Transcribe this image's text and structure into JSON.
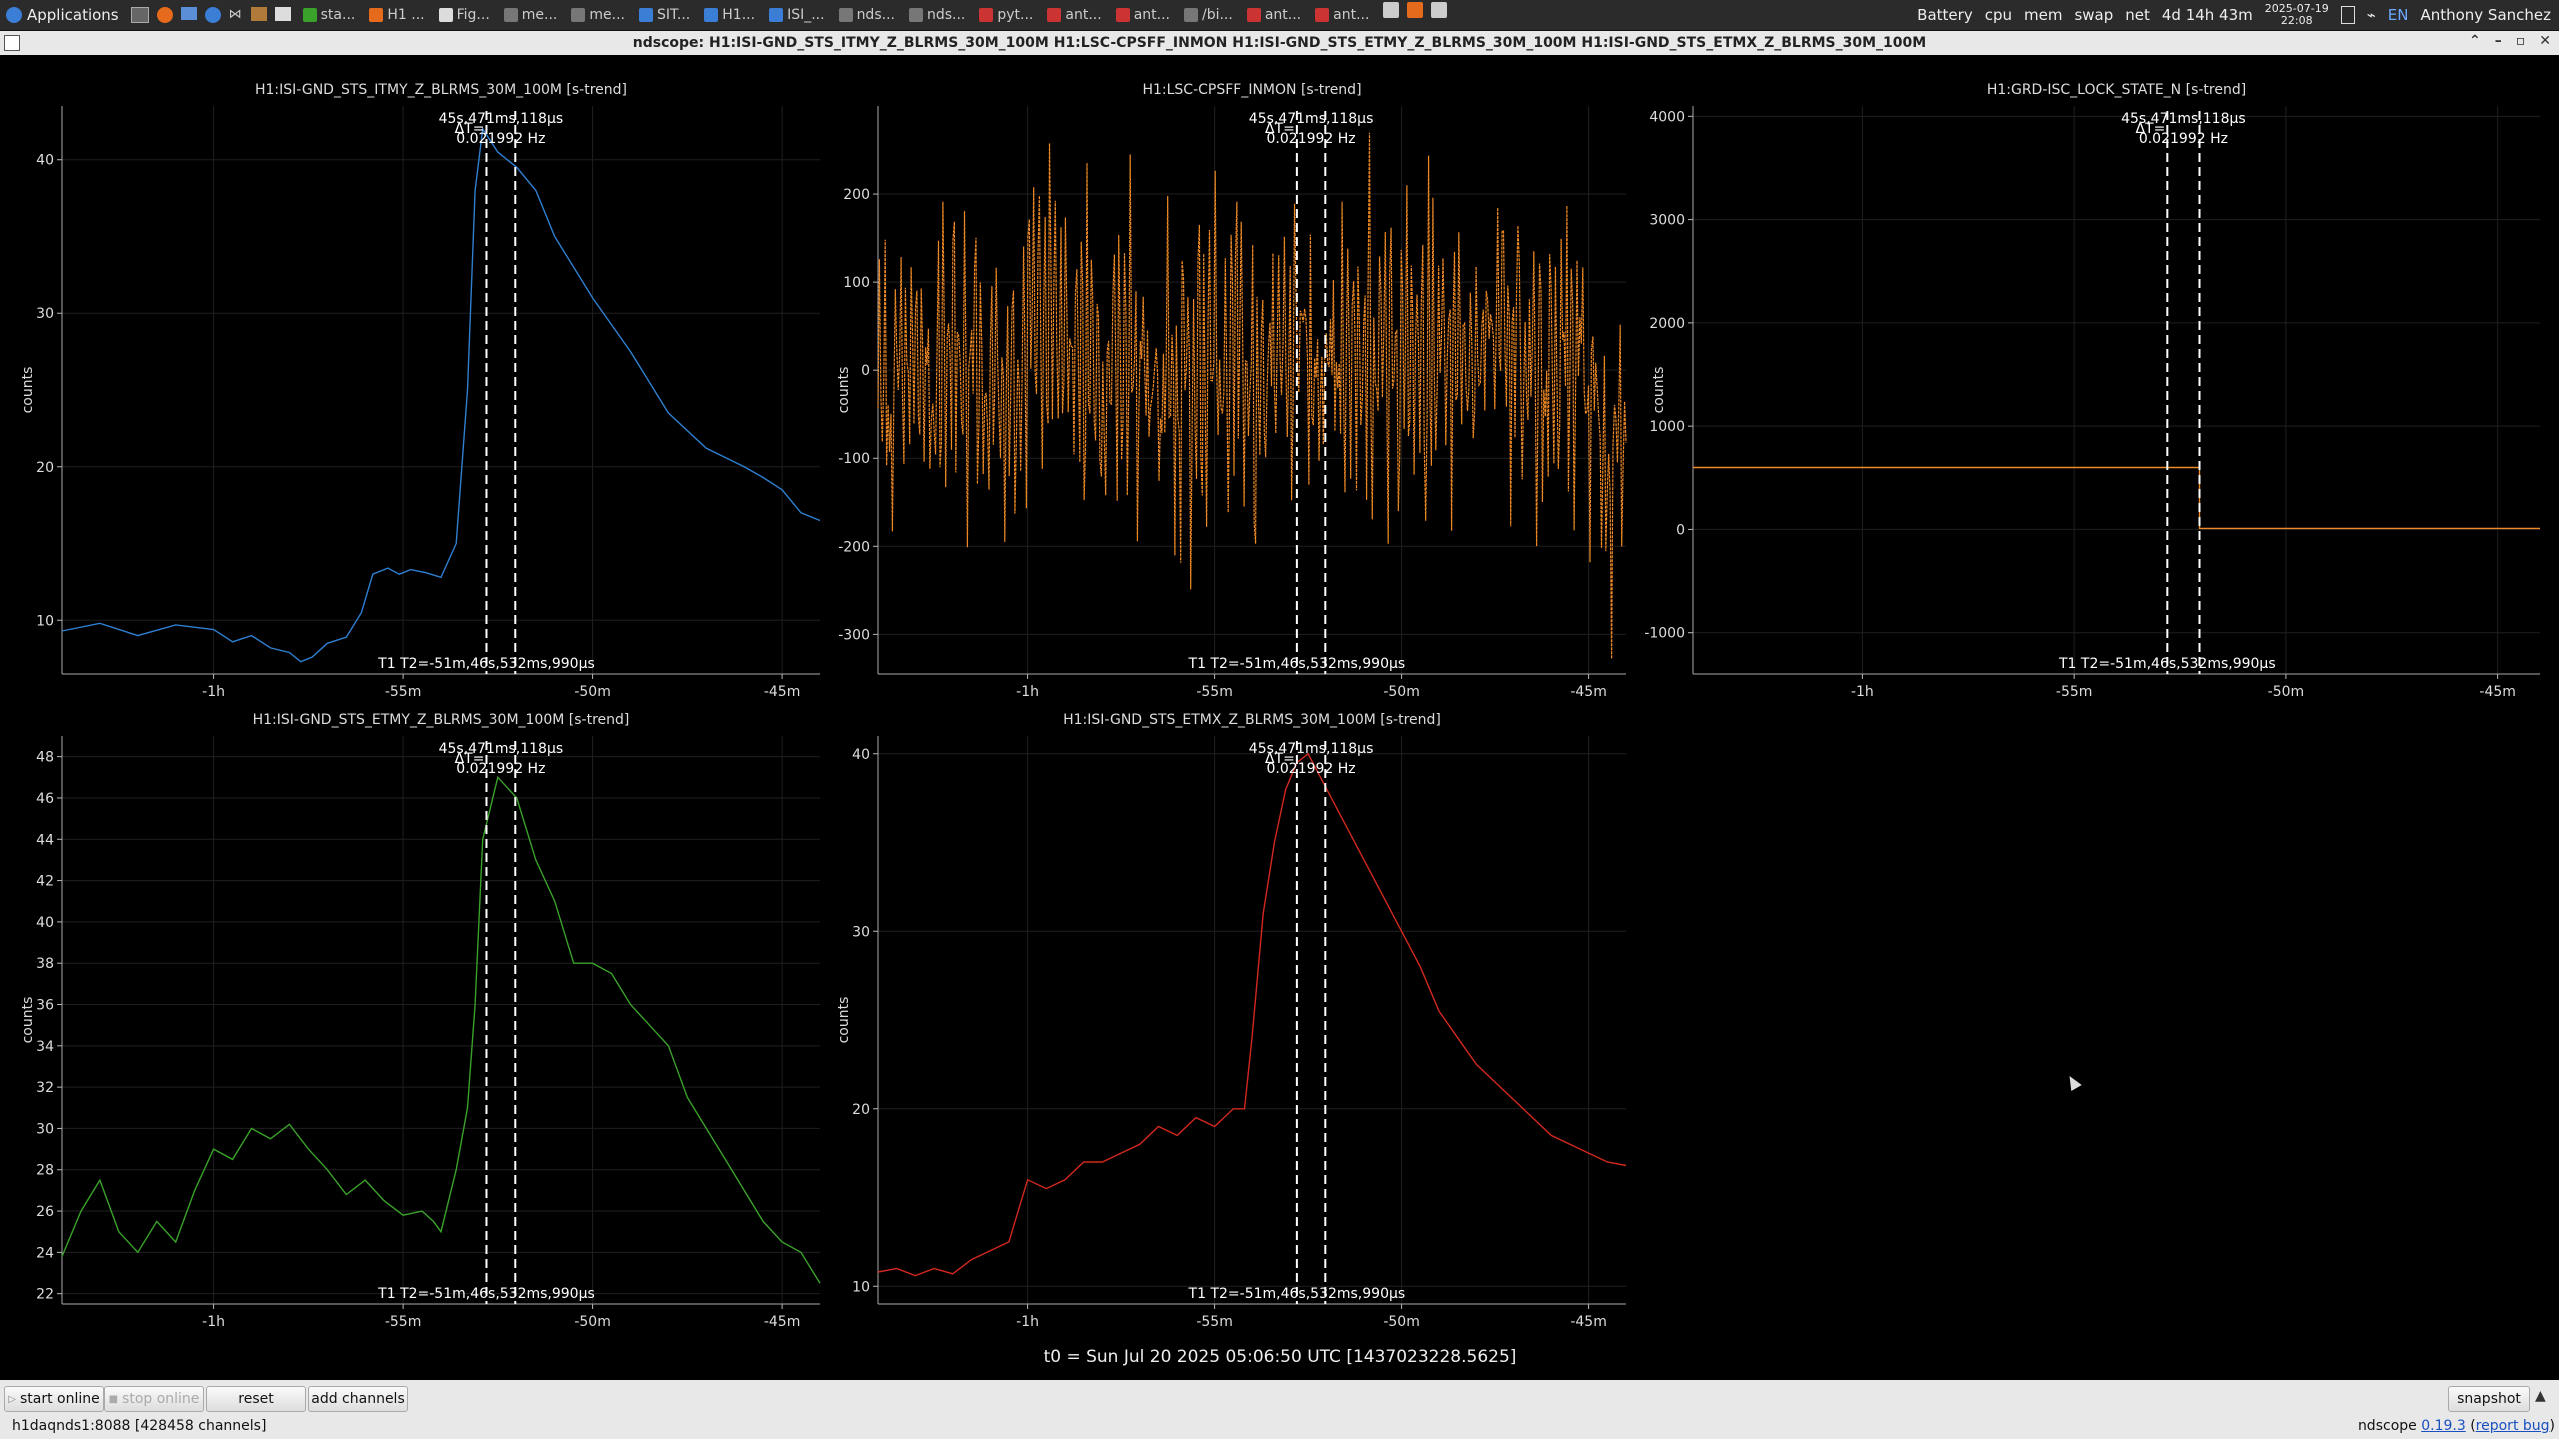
{
  "taskbar": {
    "applications_label": "Applications",
    "tasks": [
      "sta...",
      "H1 ...",
      "Fig...",
      "me...",
      "me...",
      "SIT...",
      "H1...",
      "ISI_...",
      "nds...",
      "nds...",
      "pyt...",
      "ant...",
      "ant...",
      "/bi...",
      "ant...",
      "ant..."
    ],
    "tray": {
      "battery": "Battery",
      "cpu": "cpu",
      "mem": "mem",
      "swap": "swap",
      "net": "net",
      "uptime": "4d 14h 43m",
      "date": "2025-07-19",
      "time": "22:08",
      "lang": "EN",
      "user": "Anthony Sanchez"
    }
  },
  "window": {
    "title": "ndscope: H1:ISI-GND_STS_ITMY_Z_BLRMS_30M_100M H1:LSC-CPSFF_INMON H1:ISI-GND_STS_ETMY_Z_BLRMS_30M_100M H1:ISI-GND_STS_ETMX_Z_BLRMS_30M_100M"
  },
  "cursor_text": {
    "delta": "ΔT=",
    "delta_time": "45s,471ms,118µs",
    "delta_freq": "0.021992 Hz",
    "t1t2": "T1 T2=-51m,46s,532ms,990µs"
  },
  "t0_label": "t0 = Sun Jul 20 2025 05:06:50 UTC [1437023228.5625]",
  "chart_data": [
    {
      "type": "line",
      "title": "H1:ISI-GND_STS_ITMY_Z_BLRMS_30M_100M [s-trend]",
      "ylabel": "counts",
      "color": "#2f7fd0",
      "xlim": [
        -64,
        -44
      ],
      "ylim": [
        6.5,
        43.5
      ],
      "yticks": [
        10,
        20,
        30,
        40
      ],
      "xticks": [
        {
          "v": -60,
          "l": "-1h"
        },
        {
          "v": -55,
          "l": "-55m"
        },
        {
          "v": -50,
          "l": "-50m"
        },
        {
          "v": -45,
          "l": "-45m"
        }
      ],
      "cursors": [
        -52.8,
        -52.04
      ],
      "x": [
        -64,
        -63,
        -62,
        -61,
        -60,
        -59.5,
        -59,
        -58.5,
        -58,
        -57.7,
        -57.4,
        -57,
        -56.5,
        -56.1,
        -55.8,
        -55.4,
        -55.1,
        -54.8,
        -54.4,
        -54,
        -53.6,
        -53.3,
        -53.1,
        -52.9,
        -52.5,
        -52,
        -51.5,
        -51,
        -50,
        -49,
        -48,
        -47,
        -46.5,
        -46,
        -45.5,
        -45,
        -44.5,
        -44
      ],
      "y": [
        9.3,
        9.8,
        9,
        9.7,
        9.4,
        8.6,
        9,
        8.2,
        7.9,
        7.3,
        7.6,
        8.5,
        8.9,
        10.5,
        13,
        13.4,
        13,
        13.3,
        13.1,
        12.8,
        15,
        25,
        38,
        42,
        40.5,
        39.5,
        38,
        35,
        31,
        27.5,
        23.5,
        21.2,
        20.6,
        20,
        19.3,
        18.5,
        17,
        16.5
      ]
    },
    {
      "type": "line",
      "title": "H1:LSC-CPSFF_INMON [s-trend]",
      "ylabel": "counts",
      "color": "#f08a24",
      "xlim": [
        -64,
        -44
      ],
      "ylim": [
        -345,
        300
      ],
      "yticks": [
        -300,
        -200,
        -100,
        0,
        100,
        200
      ],
      "xticks": [
        {
          "v": -60,
          "l": "-1h"
        },
        {
          "v": -55,
          "l": "-55m"
        },
        {
          "v": -50,
          "l": "-50m"
        },
        {
          "v": -45,
          "l": "-45m"
        }
      ],
      "cursors": [
        -52.8,
        -52.04
      ],
      "band_low": [
        -200,
        -150,
        -180,
        -160,
        -210,
        -140,
        -170,
        -190,
        -150,
        -175,
        -185,
        -160,
        -200,
        -170,
        -150,
        -190,
        -165,
        -175,
        -180,
        -160,
        -155,
        -170,
        -190,
        -180,
        -300
      ],
      "band_high": [
        150,
        170,
        180,
        200,
        160,
        220,
        190,
        170,
        210,
        180,
        160,
        230,
        190,
        200,
        175,
        210,
        190,
        200,
        195,
        215,
        180,
        200,
        210,
        190,
        80
      ]
    },
    {
      "type": "line",
      "title": "H1:GRD-ISC_LOCK_STATE_N [s-trend]",
      "ylabel": "counts",
      "color": "#f08a24",
      "xlim": [
        -64,
        -44
      ],
      "ylim": [
        -1400,
        4100
      ],
      "yticks": [
        -1000,
        0,
        1000,
        2000,
        3000,
        4000
      ],
      "xticks": [
        {
          "v": -60,
          "l": "-1h"
        },
        {
          "v": -55,
          "l": "-55m"
        },
        {
          "v": -50,
          "l": "-50m"
        },
        {
          "v": -45,
          "l": "-45m"
        }
      ],
      "cursors": [
        -52.8,
        -52.04
      ],
      "x": [
        -64,
        -52.04,
        -52.04,
        -44
      ],
      "y": [
        600,
        600,
        10,
        10
      ]
    },
    {
      "type": "line",
      "title": "H1:ISI-GND_STS_ETMY_Z_BLRMS_30M_100M [s-trend]",
      "ylabel": "counts",
      "color": "#3aa12a",
      "xlim": [
        -64,
        -44
      ],
      "ylim": [
        21.5,
        49
      ],
      "yticks": [
        22,
        24,
        26,
        28,
        30,
        32,
        34,
        36,
        38,
        40,
        42,
        44,
        46,
        48
      ],
      "xticks": [
        {
          "v": -60,
          "l": "-1h"
        },
        {
          "v": -55,
          "l": "-55m"
        },
        {
          "v": -50,
          "l": "-50m"
        },
        {
          "v": -45,
          "l": "-45m"
        }
      ],
      "cursors": [
        -52.8,
        -52.04
      ],
      "x": [
        -64,
        -63.5,
        -63,
        -62.5,
        -62,
        -61.5,
        -61,
        -60.5,
        -60,
        -59.5,
        -59,
        -58.5,
        -58,
        -57.5,
        -57,
        -56.5,
        -56,
        -55.5,
        -55,
        -54.5,
        -54.2,
        -54,
        -53.6,
        -53.3,
        -53.1,
        -52.9,
        -52.5,
        -52,
        -51.5,
        -51,
        -50.5,
        -50,
        -49.5,
        -49,
        -48.5,
        -48,
        -47.5,
        -47,
        -46.5,
        -46,
        -45.5,
        -45,
        -44.5,
        -44
      ],
      "y": [
        23.8,
        26,
        27.5,
        25,
        24,
        25.5,
        24.5,
        27,
        29,
        28.5,
        30,
        29.5,
        30.2,
        29,
        28,
        26.8,
        27.5,
        26.5,
        25.8,
        26,
        25.5,
        25,
        28,
        31,
        36,
        44,
        47,
        46,
        43,
        41,
        38,
        38,
        37.5,
        36,
        35,
        34,
        31.5,
        30,
        28.5,
        27,
        25.5,
        24.5,
        24,
        22.5
      ]
    },
    {
      "type": "line",
      "title": "H1:ISI-GND_STS_ETMX_Z_BLRMS_30M_100M [s-trend]",
      "ylabel": "counts",
      "color": "#d2281e",
      "xlim": [
        -64,
        -44
      ],
      "ylim": [
        9,
        41
      ],
      "yticks": [
        10,
        20,
        30,
        40
      ],
      "xticks": [
        {
          "v": -60,
          "l": "-1h"
        },
        {
          "v": -55,
          "l": "-55m"
        },
        {
          "v": -50,
          "l": "-50m"
        },
        {
          "v": -45,
          "l": "-45m"
        }
      ],
      "cursors": [
        -52.8,
        -52.04
      ],
      "x": [
        -64,
        -63.5,
        -63,
        -62.5,
        -62,
        -61.5,
        -61,
        -60.5,
        -60,
        -59.5,
        -59,
        -58.5,
        -58,
        -57.5,
        -57,
        -56.5,
        -56,
        -55.5,
        -55,
        -54.5,
        -54.2,
        -54,
        -53.7,
        -53.4,
        -53.1,
        -52.8,
        -52.5,
        -52,
        -51.5,
        -51,
        -50.5,
        -50,
        -49.5,
        -49,
        -48.5,
        -48,
        -47.5,
        -47,
        -46.5,
        -46,
        -45.5,
        -45,
        -44.5,
        -44
      ],
      "y": [
        10.8,
        11,
        10.6,
        11,
        10.7,
        11.5,
        12,
        12.5,
        16,
        15.5,
        16,
        17,
        17,
        17.5,
        18,
        19,
        18.5,
        19.5,
        19,
        20,
        20,
        24,
        31,
        35,
        38,
        39.5,
        40,
        38,
        36,
        34,
        32,
        30,
        28,
        25.5,
        24,
        22.5,
        21.5,
        20.5,
        19.5,
        18.5,
        18,
        17.5,
        17,
        16.8
      ]
    }
  ],
  "buttons": {
    "start_online": "start online",
    "stop_online": "stop online",
    "reset": "reset",
    "add_channels": "add channels",
    "snapshot": "snapshot"
  },
  "status": {
    "server": "h1daqnds1:8088  [428458 channels]",
    "version_prefix": "ndscope ",
    "version": "0.19.3",
    "report_bug": "report bug"
  }
}
